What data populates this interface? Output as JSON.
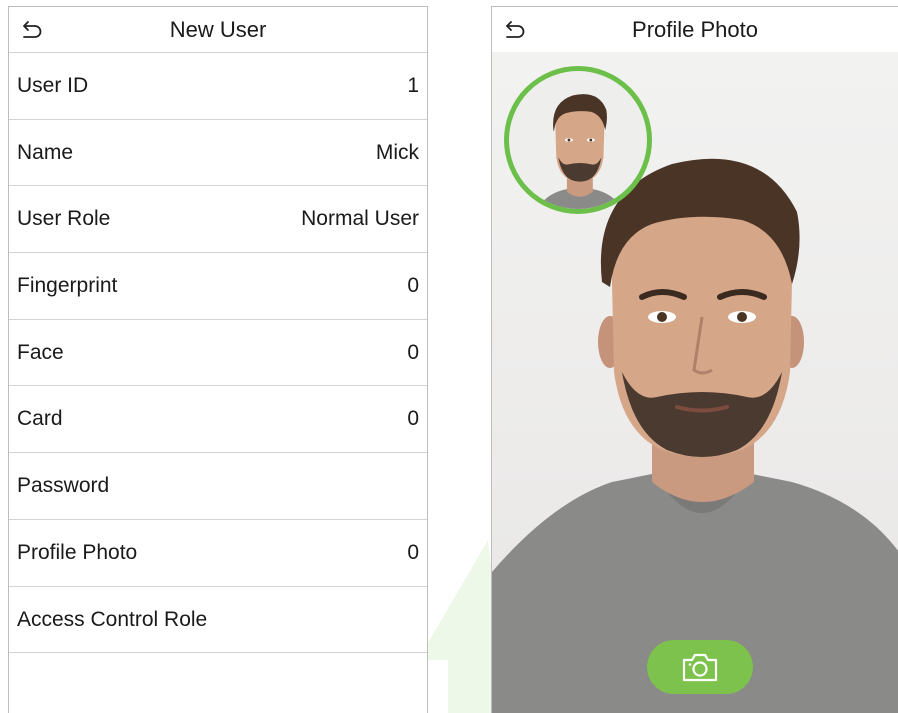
{
  "left_panel": {
    "title": "New User",
    "back_icon": "back-arrow-icon",
    "rows": [
      {
        "label": "User ID",
        "value": "1"
      },
      {
        "label": "Name",
        "value": "Mick"
      },
      {
        "label": "User Role",
        "value": "Normal User"
      },
      {
        "label": "Fingerprint",
        "value": "0"
      },
      {
        "label": "Face",
        "value": "0"
      },
      {
        "label": "Card",
        "value": "0"
      },
      {
        "label": "Password",
        "value": ""
      },
      {
        "label": "Profile Photo",
        "value": "0"
      },
      {
        "label": "Access Control Role",
        "value": ""
      }
    ]
  },
  "right_panel": {
    "title": "Profile Photo",
    "back_icon": "back-arrow-icon",
    "capture_icon": "camera-icon"
  },
  "colors": {
    "accent_green": "#6cc04a",
    "button_green": "#7cc24c",
    "divider": "#d4d4d4"
  }
}
